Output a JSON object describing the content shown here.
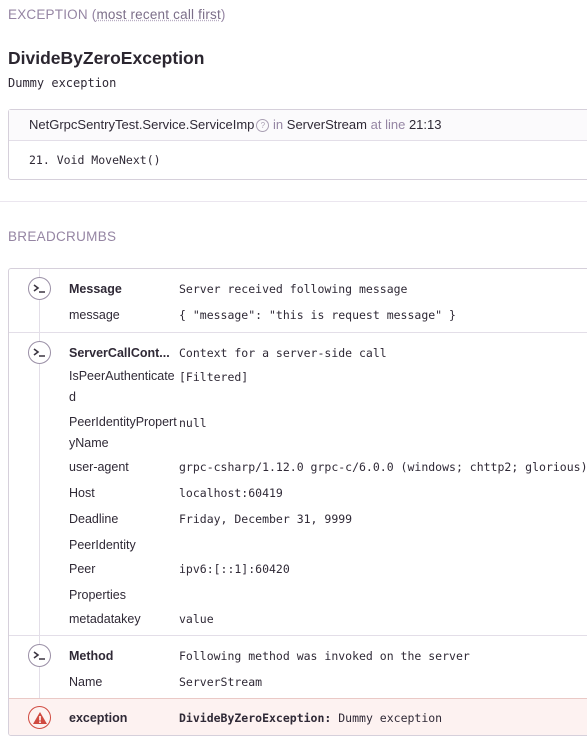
{
  "exception": {
    "header_label": "Exception",
    "header_sub": "most recent call first",
    "type": "DivideByZeroException",
    "value": "Dummy exception",
    "frame": {
      "function": "NetGrpcSentryTest.Service.ServiceImp",
      "info_glyph": "?",
      "in_text": "in",
      "method": "ServerStream",
      "at_line_text": "at line",
      "line": "21:13",
      "code_line": "21. Void MoveNext()"
    }
  },
  "breadcrumbs": {
    "title": "BREADCRUMBS",
    "crumbs": [
      {
        "icon": "chevron-terminal-icon",
        "rows": [
          {
            "key": "Message",
            "value": "Server received following message"
          },
          {
            "key": "message",
            "value": "{ \"message\": \"this is request message\" }"
          }
        ]
      },
      {
        "icon": "chevron-terminal-icon",
        "rows": [
          {
            "key": "ServerCallCont...",
            "value": "Context for a server-side call"
          },
          {
            "key": "IsPeerAuthenticated",
            "value": "[Filtered]"
          },
          {
            "key": "PeerIdentityPropertyName",
            "value": "null"
          },
          {
            "key": "user-agent",
            "value": "grpc-csharp/1.12.0 grpc-c/6.0.0 (windows; chttp2; glorious)"
          },
          {
            "key": "Host",
            "value": "localhost:60419"
          },
          {
            "key": "Deadline",
            "value": "Friday, December 31, 9999"
          },
          {
            "key": "PeerIdentity",
            "value": ""
          },
          {
            "key": "Peer",
            "value": "ipv6:[::1]:60420"
          },
          {
            "key": "Properties",
            "value": ""
          },
          {
            "key": "metadatakey",
            "value": "value"
          }
        ]
      },
      {
        "icon": "chevron-terminal-icon",
        "rows": [
          {
            "key": "Method",
            "value": "Following method was invoked on the server"
          },
          {
            "key": "Name",
            "value": "ServerStream"
          }
        ]
      },
      {
        "icon": "warning-icon",
        "rows": [
          {
            "key": "exception",
            "value_type": "DivideByZeroException:",
            "value": " Dummy exception"
          }
        ]
      }
    ]
  },
  "colors": {
    "muted": "#9585a3",
    "error": "#d04a40",
    "border": "#d6d0db"
  }
}
